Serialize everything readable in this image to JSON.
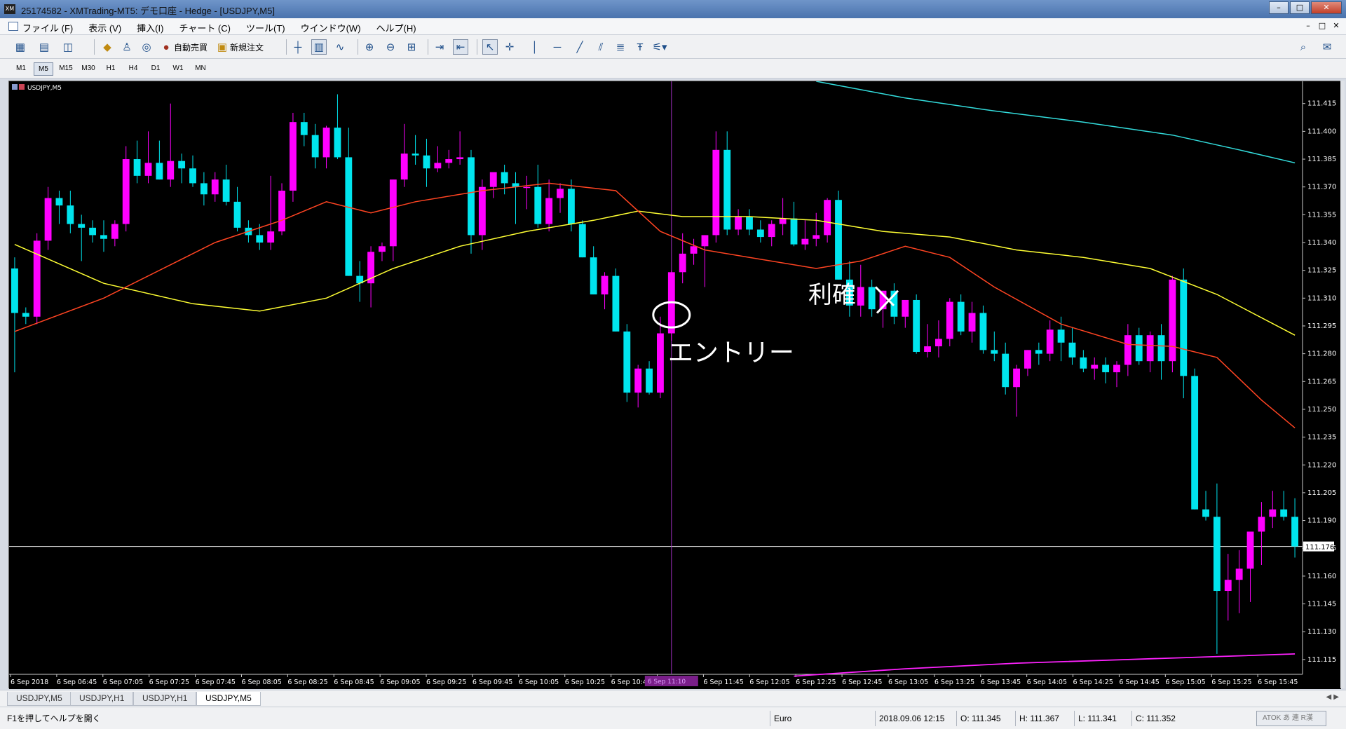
{
  "window": {
    "title": "25174582 - XMTrading-MT5: デモ口座 - Hedge - [USDJPY,M5]",
    "app_icon": "XM",
    "min_glyph": "–",
    "max_glyph": "□",
    "close_glyph": "✕"
  },
  "menu": [
    "ファイル (F)",
    "表示 (V)",
    "挿入(I)",
    "チャート (C)",
    "ツール(T)",
    "ウインドウ(W)",
    "ヘルプ(H)"
  ],
  "toolbar": {
    "auto_trade": "自動売買",
    "new_order": "新規注文"
  },
  "timeframes": [
    "M1",
    "M5",
    "M15",
    "M30",
    "H1",
    "H4",
    "D1",
    "W1",
    "MN"
  ],
  "active_timeframe": "M5",
  "chart": {
    "label": "USDJPY,M5",
    "current_price": "111.176",
    "cursor_time_label": "6 Sep 11:10",
    "annotations": {
      "entry": "エントリー",
      "take_profit": "利確"
    },
    "colors": {
      "background": "#000000",
      "bull": "#ff00ff",
      "bear": "#00e5ee",
      "ma_fast": "#ff4422",
      "ma_mid": "#ffff33",
      "ma_slow": "#33dddd",
      "ma_bottom": "#ff22ff",
      "crosshair": "#a030c0"
    }
  },
  "chart_data": {
    "type": "candlestick",
    "symbol": "USDJPY",
    "timeframe": "M5",
    "ylim": [
      111.107,
      111.427
    ],
    "y_ticks": [
      "111.415",
      "111.400",
      "111.385",
      "111.370",
      "111.355",
      "111.340",
      "111.325",
      "111.310",
      "111.295",
      "111.280",
      "111.265",
      "111.250",
      "111.235",
      "111.220",
      "111.205",
      "111.190",
      "111.175",
      "111.160",
      "111.145",
      "111.130",
      "111.115"
    ],
    "x_ticks": [
      "6 Sep 2018",
      "6 Sep 06:45",
      "6 Sep 07:05",
      "6 Sep 07:25",
      "6 Sep 07:45",
      "6 Sep 08:05",
      "6 Sep 08:25",
      "6 Sep 08:45",
      "6 Sep 09:05",
      "6 Sep 09:25",
      "6 Sep 09:45",
      "6 Sep 10:05",
      "6 Sep 10:25",
      "6 Sep 10:45",
      "6 Sep 11:",
      "6 Sep 11:45",
      "6 Sep 12:05",
      "6 Sep 12:25",
      "6 Sep 12:45",
      "6 Sep 13:05",
      "6 Sep 13:25",
      "6 Sep 13:45",
      "6 Sep 14:05",
      "6 Sep 14:25",
      "6 Sep 14:45",
      "6 Sep 15:05",
      "6 Sep 15:25",
      "6 Sep 15:45"
    ],
    "candles": [
      [
        111.326,
        111.332,
        111.27,
        111.302
      ],
      [
        111.302,
        111.305,
        111.296,
        111.3
      ],
      [
        111.3,
        111.345,
        111.296,
        111.341
      ],
      [
        111.341,
        111.37,
        111.336,
        111.364
      ],
      [
        111.364,
        111.368,
        111.35,
        111.36
      ],
      [
        111.36,
        111.368,
        111.345,
        111.35
      ],
      [
        111.35,
        111.355,
        111.33,
        111.348
      ],
      [
        111.348,
        111.352,
        111.34,
        111.344
      ],
      [
        111.344,
        111.352,
        111.335,
        111.342
      ],
      [
        111.342,
        111.352,
        111.338,
        111.35
      ],
      [
        111.35,
        111.392,
        111.346,
        111.385
      ],
      [
        111.385,
        111.395,
        111.372,
        111.376
      ],
      [
        111.376,
        111.4,
        111.372,
        111.383
      ],
      [
        111.383,
        111.395,
        111.374,
        111.374
      ],
      [
        111.374,
        111.415,
        111.37,
        111.384
      ],
      [
        111.384,
        111.388,
        111.372,
        111.38
      ],
      [
        111.38,
        111.387,
        111.37,
        111.372
      ],
      [
        111.372,
        111.378,
        111.36,
        111.366
      ],
      [
        111.366,
        111.378,
        111.362,
        111.374
      ],
      [
        111.374,
        111.382,
        111.36,
        111.362
      ],
      [
        111.362,
        111.37,
        111.346,
        111.348
      ],
      [
        111.348,
        111.352,
        111.34,
        111.344
      ],
      [
        111.344,
        111.35,
        111.336,
        111.34
      ],
      [
        111.34,
        111.376,
        111.336,
        111.346
      ],
      [
        111.346,
        111.372,
        111.344,
        111.368
      ],
      [
        111.368,
        111.41,
        111.362,
        111.405
      ],
      [
        111.405,
        111.41,
        111.392,
        111.398
      ],
      [
        111.398,
        111.404,
        111.38,
        111.386
      ],
      [
        111.386,
        111.403,
        111.38,
        111.402
      ],
      [
        111.402,
        111.42,
        111.385,
        111.386
      ],
      [
        111.386,
        111.402,
        111.322,
        111.322
      ],
      [
        111.322,
        111.33,
        111.308,
        111.318
      ],
      [
        111.318,
        111.338,
        111.305,
        111.335
      ],
      [
        111.335,
        111.34,
        111.33,
        111.338
      ],
      [
        111.338,
        111.374,
        111.33,
        111.374
      ],
      [
        111.374,
        111.404,
        111.37,
        111.388
      ],
      [
        111.388,
        111.398,
        111.382,
        111.387
      ],
      [
        111.387,
        111.396,
        111.37,
        111.38
      ],
      [
        111.38,
        111.392,
        111.378,
        111.383
      ],
      [
        111.383,
        111.39,
        111.38,
        111.385
      ],
      [
        111.385,
        111.4,
        111.382,
        111.386
      ],
      [
        111.386,
        111.39,
        111.334,
        111.344
      ],
      [
        111.344,
        111.374,
        111.336,
        111.37
      ],
      [
        111.37,
        111.374,
        111.364,
        111.378
      ],
      [
        111.378,
        111.382,
        111.366,
        111.372
      ],
      [
        111.372,
        111.378,
        111.35,
        111.37
      ],
      [
        111.37,
        111.376,
        111.358,
        111.37
      ],
      [
        111.37,
        111.382,
        111.348,
        111.35
      ],
      [
        111.35,
        111.374,
        111.346,
        111.364
      ],
      [
        111.364,
        111.372,
        111.356,
        111.369
      ],
      [
        111.369,
        111.374,
        111.346,
        111.35
      ],
      [
        111.35,
        111.352,
        111.332,
        111.332
      ],
      [
        111.332,
        111.338,
        111.312,
        111.312
      ],
      [
        111.312,
        111.324,
        111.304,
        111.322
      ],
      [
        111.322,
        111.326,
        111.292,
        111.292
      ],
      [
        111.292,
        111.296,
        111.254,
        111.259
      ],
      [
        111.259,
        111.274,
        111.251,
        111.272
      ],
      [
        111.272,
        111.276,
        111.258,
        111.259
      ],
      [
        111.259,
        111.3,
        111.256,
        111.291
      ],
      [
        111.291,
        111.325,
        111.287,
        111.324
      ],
      [
        111.324,
        111.345,
        111.318,
        111.334
      ],
      [
        111.334,
        111.342,
        111.328,
        111.338
      ],
      [
        111.338,
        111.344,
        111.316,
        111.344
      ],
      [
        111.344,
        111.4,
        111.34,
        111.39
      ],
      [
        111.39,
        111.4,
        111.344,
        111.347
      ],
      [
        111.347,
        111.358,
        111.344,
        111.354
      ],
      [
        111.354,
        111.358,
        111.344,
        111.347
      ],
      [
        111.347,
        111.352,
        111.34,
        111.343
      ],
      [
        111.343,
        111.352,
        111.338,
        111.35
      ],
      [
        111.35,
        111.364,
        111.344,
        111.353
      ],
      [
        111.353,
        111.362,
        111.338,
        111.339
      ],
      [
        111.339,
        111.352,
        111.336,
        111.342
      ],
      [
        111.342,
        111.356,
        111.338,
        111.344
      ],
      [
        111.344,
        111.364,
        111.34,
        111.363
      ],
      [
        111.363,
        111.368,
        111.32,
        111.32
      ],
      [
        111.32,
        111.33,
        111.3,
        111.306
      ],
      [
        111.306,
        111.328,
        111.3,
        111.316
      ],
      [
        111.316,
        111.32,
        111.3,
        111.304
      ],
      [
        111.304,
        111.314,
        111.294,
        111.314
      ],
      [
        111.314,
        111.318,
        111.296,
        111.3
      ],
      [
        111.3,
        111.308,
        111.294,
        111.309
      ],
      [
        111.309,
        111.312,
        111.28,
        111.281
      ],
      [
        111.281,
        111.296,
        111.278,
        111.284
      ],
      [
        111.284,
        111.298,
        111.278,
        111.288
      ],
      [
        111.288,
        111.31,
        111.284,
        111.308
      ],
      [
        111.308,
        111.312,
        111.29,
        111.292
      ],
      [
        111.292,
        111.308,
        111.286,
        111.302
      ],
      [
        111.302,
        111.306,
        111.28,
        111.282
      ],
      [
        111.282,
        111.292,
        111.276,
        111.28
      ],
      [
        111.28,
        111.286,
        111.258,
        111.262
      ],
      [
        111.262,
        111.274,
        111.246,
        111.272
      ],
      [
        111.272,
        111.282,
        111.268,
        111.282
      ],
      [
        111.282,
        111.286,
        111.274,
        111.28
      ],
      [
        111.28,
        111.298,
        111.276,
        111.293
      ],
      [
        111.293,
        111.3,
        111.276,
        111.286
      ],
      [
        111.286,
        111.294,
        111.274,
        111.278
      ],
      [
        111.278,
        111.282,
        111.27,
        111.272
      ],
      [
        111.272,
        111.278,
        111.266,
        111.274
      ],
      [
        111.274,
        111.278,
        111.264,
        111.27
      ],
      [
        111.27,
        111.276,
        111.262,
        111.274
      ],
      [
        111.274,
        111.296,
        111.268,
        111.29
      ],
      [
        111.29,
        111.294,
        111.274,
        111.276
      ],
      [
        111.276,
        111.292,
        111.27,
        111.29
      ],
      [
        111.29,
        111.296,
        111.266,
        111.276
      ],
      [
        111.276,
        111.322,
        111.27,
        111.32
      ],
      [
        111.32,
        111.326,
        111.256,
        111.268
      ],
      [
        111.268,
        111.272,
        111.196,
        111.196
      ],
      [
        111.196,
        111.206,
        111.19,
        111.192
      ],
      [
        111.192,
        111.21,
        111.118,
        111.152
      ],
      [
        111.152,
        111.172,
        111.136,
        111.158
      ],
      [
        111.158,
        111.174,
        111.14,
        111.164
      ],
      [
        111.164,
        111.18,
        111.146,
        111.184
      ],
      [
        111.184,
        111.2,
        111.166,
        111.192
      ],
      [
        111.192,
        111.206,
        111.186,
        111.196
      ],
      [
        111.196,
        111.206,
        111.19,
        111.192
      ],
      [
        111.192,
        111.202,
        111.17,
        111.176
      ]
    ],
    "ma_fast": [
      [
        0,
        111.292
      ],
      [
        8,
        111.31
      ],
      [
        18,
        111.34
      ],
      [
        24,
        111.352
      ],
      [
        28,
        111.362
      ],
      [
        32,
        111.356
      ],
      [
        36,
        111.362
      ],
      [
        42,
        111.368
      ],
      [
        48,
        111.372
      ],
      [
        54,
        111.368
      ],
      [
        58,
        111.346
      ],
      [
        62,
        111.336
      ],
      [
        66,
        111.332
      ],
      [
        72,
        111.326
      ],
      [
        76,
        111.33
      ],
      [
        80,
        111.338
      ],
      [
        84,
        111.332
      ],
      [
        88,
        111.316
      ],
      [
        94,
        111.296
      ],
      [
        100,
        111.285
      ],
      [
        104,
        111.284
      ],
      [
        108,
        111.278
      ],
      [
        112,
        111.255
      ],
      [
        115,
        111.24
      ]
    ],
    "ma_mid": [
      [
        0,
        111.339
      ],
      [
        8,
        111.318
      ],
      [
        16,
        111.307
      ],
      [
        22,
        111.303
      ],
      [
        28,
        111.31
      ],
      [
        34,
        111.326
      ],
      [
        40,
        111.338
      ],
      [
        46,
        111.346
      ],
      [
        52,
        111.352
      ],
      [
        56,
        111.357
      ],
      [
        60,
        111.354
      ],
      [
        66,
        111.354
      ],
      [
        72,
        111.352
      ],
      [
        78,
        111.346
      ],
      [
        84,
        111.343
      ],
      [
        90,
        111.336
      ],
      [
        96,
        111.332
      ],
      [
        102,
        111.326
      ],
      [
        108,
        111.312
      ],
      [
        115,
        111.29
      ]
    ],
    "ma_slow": [
      [
        72,
        111.427
      ],
      [
        80,
        111.418
      ],
      [
        88,
        111.411
      ],
      [
        96,
        111.405
      ],
      [
        104,
        111.398
      ],
      [
        110,
        111.39
      ],
      [
        115,
        111.383
      ]
    ],
    "ma_bottom": [
      [
        70,
        111.106
      ],
      [
        80,
        111.11
      ],
      [
        90,
        111.113
      ],
      [
        100,
        111.115
      ],
      [
        110,
        111.117
      ],
      [
        115,
        111.118
      ]
    ]
  },
  "tabs": [
    "USDJPY,M5",
    "USDJPY,H1",
    "USDJPY,H1",
    "USDJPY,M5"
  ],
  "active_tab": 3,
  "tab_arrows": "◀ ▶",
  "status": {
    "help": "F1を押してヘルプを開く",
    "profile": "Euro",
    "datetime": "2018.09.06 12:15",
    "open": "O: 111.345",
    "high": "H: 111.367",
    "low": "L: 111.341",
    "close": "C: 111.352",
    "ime": "ATOK  あ  連  R漢"
  }
}
